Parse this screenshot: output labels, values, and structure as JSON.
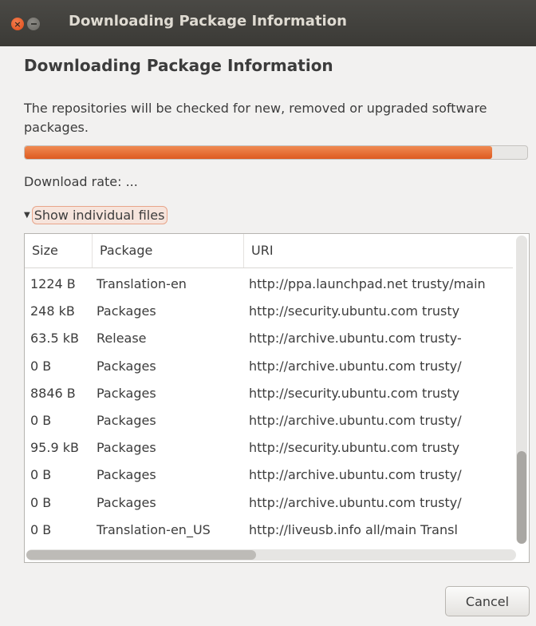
{
  "window": {
    "title": "Downloading Package Information",
    "close_glyph": "×"
  },
  "dialog": {
    "heading": "Downloading Package Information",
    "description": "The repositories will be checked for new, removed or upgraded software packages.",
    "progress_percent": 93,
    "download_rate": "Download rate: ...",
    "expander_label": "Show individual files",
    "expander_arrow": "▼"
  },
  "files_table": {
    "columns": {
      "size": "Size",
      "package": "Package",
      "uri": "URI"
    },
    "rows": [
      {
        "size": "1224 B",
        "package": "Translation-en",
        "uri": "http://ppa.launchpad.net trusty/main"
      },
      {
        "size": "248 kB",
        "package": "Packages",
        "uri": "http://security.ubuntu.com trusty"
      },
      {
        "size": "63.5 kB",
        "package": "Release",
        "uri": "http://archive.ubuntu.com trusty-"
      },
      {
        "size": "0 B",
        "package": "Packages",
        "uri": "http://archive.ubuntu.com trusty/"
      },
      {
        "size": "8846 B",
        "package": "Packages",
        "uri": "http://security.ubuntu.com trusty"
      },
      {
        "size": "0 B",
        "package": "Packages",
        "uri": "http://archive.ubuntu.com trusty/"
      },
      {
        "size": "95.9 kB",
        "package": "Packages",
        "uri": "http://security.ubuntu.com trusty"
      },
      {
        "size": "0 B",
        "package": "Packages",
        "uri": "http://archive.ubuntu.com trusty/"
      },
      {
        "size": "0 B",
        "package": "Packages",
        "uri": "http://archive.ubuntu.com trusty/"
      },
      {
        "size": "0 B",
        "package": "Translation-en_US",
        "uri": "http://liveusb.info all/main Transl"
      }
    ]
  },
  "buttons": {
    "cancel": "Cancel"
  },
  "colors": {
    "progress": "#dd5a20",
    "titlebar": "#3b3a36",
    "close": "#df4a16"
  },
  "icons": {
    "close": "close-icon",
    "minimize": "minimize-icon",
    "expander": "triangle-down-icon"
  }
}
